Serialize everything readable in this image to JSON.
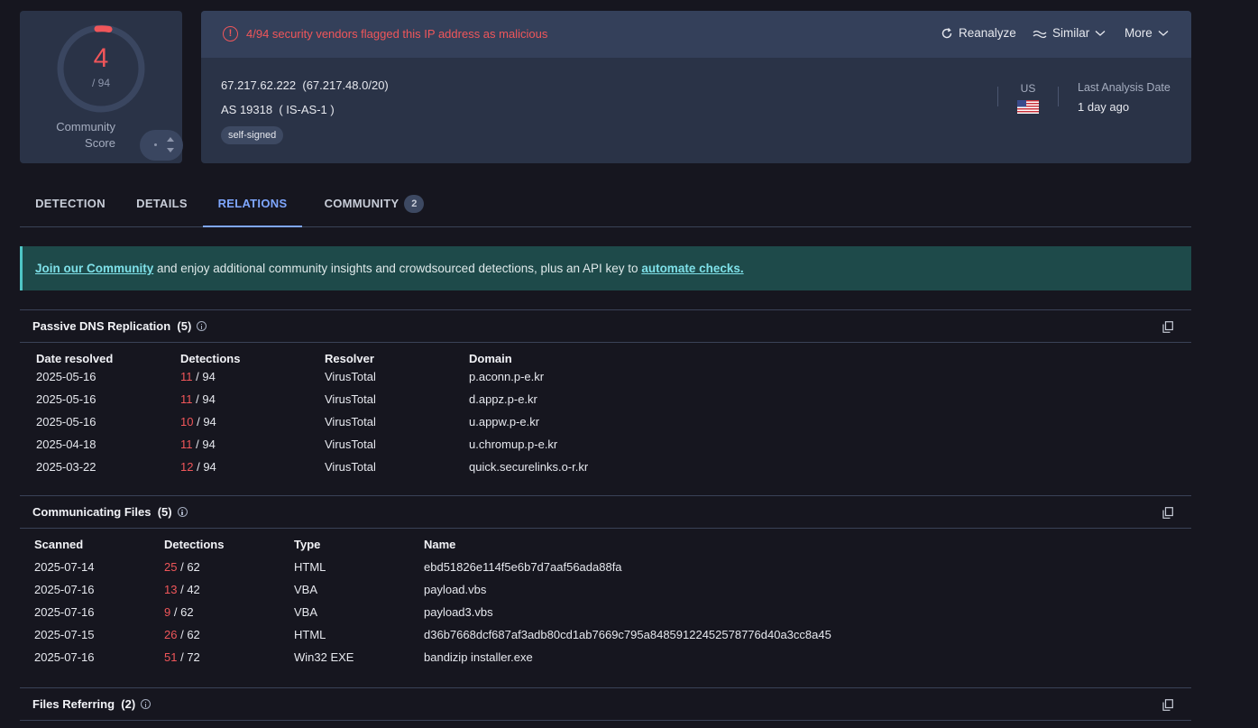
{
  "score": {
    "detected": "4",
    "total": "/ 94",
    "community_label_line1": "Community",
    "community_label_line2": "Score"
  },
  "header": {
    "alert": "4/94 security vendors flagged this IP address as malicious",
    "actions": {
      "reanalyze": "Reanalyze",
      "similar": "Similar",
      "more": "More"
    },
    "ip": "67.217.62.222  (67.217.48.0/20)",
    "as": "AS 19318  ( IS-AS-1 )",
    "tag": "self-signed",
    "country": "US",
    "last_analysis_label": "Last Analysis Date",
    "last_analysis_value": "1 day ago"
  },
  "tabs": [
    {
      "label": "DETECTION"
    },
    {
      "label": "DETAILS"
    },
    {
      "label": "RELATIONS"
    },
    {
      "label": "COMMUNITY",
      "badge": "2"
    }
  ],
  "banner": {
    "link1": "Join our Community",
    "middle": " and enjoy additional community insights and crowdsourced detections, plus an API key to ",
    "link2": "automate checks."
  },
  "passive_dns": {
    "title": "Passive DNS Replication",
    "count": "(5)",
    "columns": [
      "Date resolved",
      "Detections",
      "Resolver",
      "Domain"
    ],
    "rows": [
      {
        "date": "2025-05-16",
        "det": "11",
        "total": "/ 94",
        "resolver": "VirusTotal",
        "domain": "p.aconn.p-e.kr"
      },
      {
        "date": "2025-05-16",
        "det": "11",
        "total": "/ 94",
        "resolver": "VirusTotal",
        "domain": "d.appz.p-e.kr"
      },
      {
        "date": "2025-05-16",
        "det": "10",
        "total": "/ 94",
        "resolver": "VirusTotal",
        "domain": "u.appw.p-e.kr"
      },
      {
        "date": "2025-04-18",
        "det": "11",
        "total": "/ 94",
        "resolver": "VirusTotal",
        "domain": "u.chromup.p-e.kr"
      },
      {
        "date": "2025-03-22",
        "det": "12",
        "total": "/ 94",
        "resolver": "VirusTotal",
        "domain": "quick.securelinks.o-r.kr"
      }
    ]
  },
  "communicating_files": {
    "title": "Communicating Files",
    "count": "(5)",
    "columns": [
      "Scanned",
      "Detections",
      "Type",
      "Name"
    ],
    "rows": [
      {
        "date": "2025-07-14",
        "det": "25",
        "total": "/ 62",
        "type": "HTML",
        "name": "ebd51826e114f5e6b7d7aaf56ada88fa"
      },
      {
        "date": "2025-07-16",
        "det": "13",
        "total": "/ 42",
        "type": "VBA",
        "name": "payload.vbs"
      },
      {
        "date": "2025-07-16",
        "det": "9",
        "total": "/ 62",
        "type": "VBA",
        "name": "payload3.vbs"
      },
      {
        "date": "2025-07-15",
        "det": "26",
        "total": "/ 62",
        "type": "HTML",
        "name": "d36b7668dcf687af3adb80cd1ab7669c795a84859122452578776d40a3cc8a45"
      },
      {
        "date": "2025-07-16",
        "det": "51",
        "total": "/ 72",
        "type": "Win32 EXE",
        "name": "bandizip installer.exe"
      }
    ]
  },
  "files_referring": {
    "title": "Files Referring",
    "count": "(2)"
  }
}
